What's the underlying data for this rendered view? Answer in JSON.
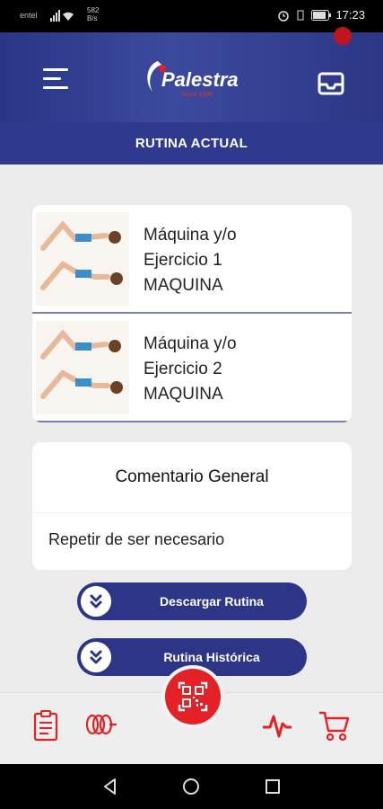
{
  "status_bar": {
    "carrier": "entel",
    "speed": "582",
    "speed_unit": "B/s",
    "time": "17:23"
  },
  "header": {
    "logo_text": "Palestra",
    "logo_tagline": "Since 1989"
  },
  "subheader": {
    "title": "RUTINA ACTUAL"
  },
  "exercises": [
    {
      "line1": "Máquina y/o",
      "line2": "Ejercicio 1",
      "line3": "MAQUINA"
    },
    {
      "line1": "Máquina y/o",
      "line2": "Ejercicio 2",
      "line3": "MAQUINA"
    }
  ],
  "comment": {
    "title": "Comentario General",
    "body": "Repetir de ser necesario"
  },
  "buttons": {
    "download": "Descargar Rutina",
    "history": "Rutina Histórica"
  },
  "bottom_nav": {
    "icons": [
      "clipboard-icon",
      "scale-weights-icon",
      "qr-code-icon",
      "heartbeat-icon",
      "cart-icon"
    ]
  },
  "colors": {
    "primary": "#2c3586",
    "accent": "#e32126"
  }
}
